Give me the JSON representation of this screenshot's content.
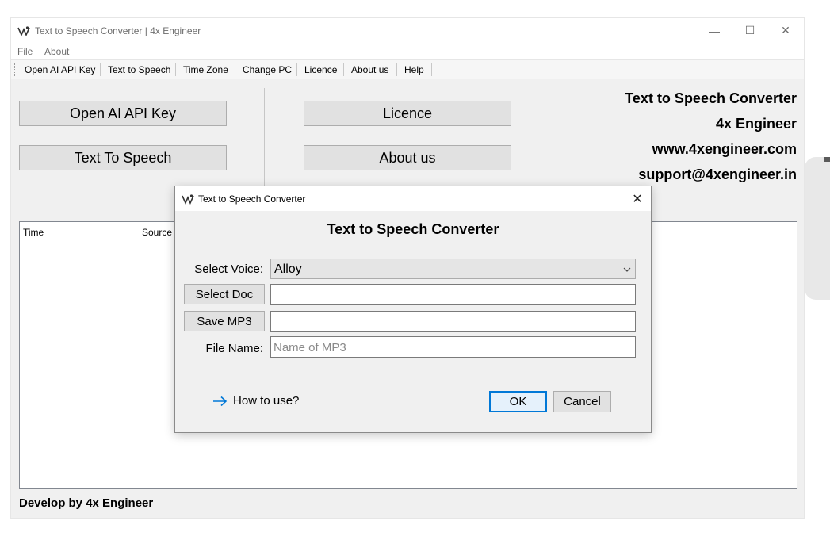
{
  "window": {
    "title": "Text to Speech Converter | 4x Engineer",
    "controls": {
      "minimize": "—",
      "maximize": "☐",
      "close": "✕"
    }
  },
  "menu": {
    "items": [
      "File",
      "About"
    ]
  },
  "toolbar": {
    "items": [
      "Open AI API Key",
      "Text to Speech",
      "Time Zone",
      "Change PC",
      "Licence",
      "About us",
      "Help"
    ]
  },
  "buttons": {
    "open_ai_api_key": "Open AI API Key",
    "text_to_speech": "Text To Speech",
    "licence": "Licence",
    "about_us": "About us"
  },
  "info": {
    "product": "Text to Speech Converter",
    "company": "4x Engineer",
    "website": "www.4xengineer.com",
    "support": "support@4xengineer.in"
  },
  "log_table": {
    "columns": [
      "Time",
      "Source"
    ],
    "rows": []
  },
  "footer": {
    "text": "Develop by 4x Engineer"
  },
  "dialog": {
    "title": "Text to Speech Converter",
    "close": "✕",
    "heading": "Text to Speech Converter",
    "select_voice_label": "Select Voice:",
    "voice_value": "Alloy",
    "select_doc_button": "Select Doc",
    "doc_path_value": "",
    "save_mp3_button": "Save MP3",
    "mp3_path_value": "",
    "file_name_label": "File Name:",
    "file_name_placeholder": "Name of MP3",
    "how_to_use": "How to use?",
    "ok_button": "OK",
    "cancel_button": "Cancel"
  },
  "icons": {
    "app": "app-logo-icon",
    "dropdown": "chevron-down-icon",
    "link": "arrow-right-icon"
  },
  "colors": {
    "accent": "#0078d7",
    "window_bg": "#f0f0f0",
    "button_bg": "#e1e1e1"
  }
}
